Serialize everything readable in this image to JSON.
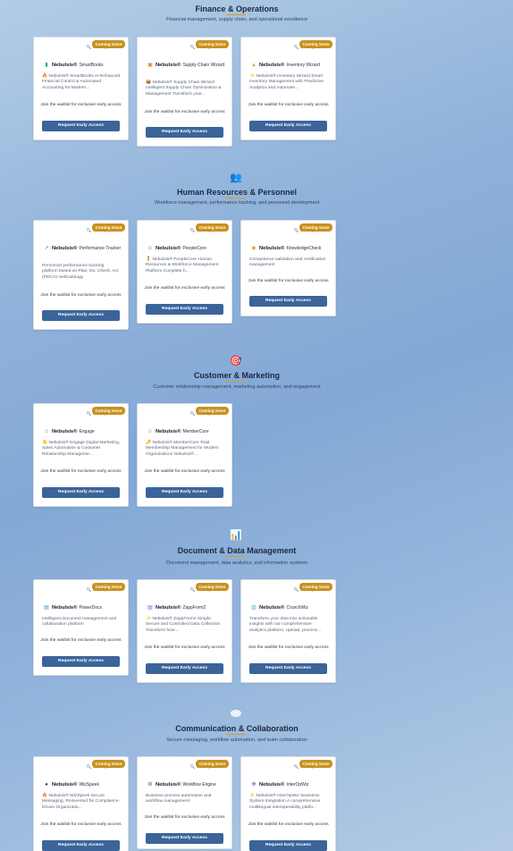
{
  "sections": [
    {
      "icon": "",
      "title_a": "Finance",
      "title_amp": " & ",
      "title_b": "Operations",
      "subtitle": "Financial management, supply chain, and operational excellence",
      "cards": [
        {
          "brand": "Nebulsis®",
          "product": "SmartBooks",
          "icon": "books-icon",
          "desc": "🔥 Nebulsis® SmartBooks AI-Enhanced Financial Control & Automated Accounting for Modern...",
          "waitlist": "Join the waitlist for exclusive early access",
          "button": "Request Early Access",
          "badge": "Coming Soon"
        },
        {
          "brand": "Nebulsis®",
          "product": "Supply Chain Wizard",
          "icon": "truck-icon",
          "desc": "📦 Nebulsis® Supply Chain Wizard Intelligent Supply Chain Optimization & Management Transform your...",
          "waitlist": "Join the waitlist for exclusive early access",
          "button": "Request Early Access",
          "badge": "Coming Soon"
        },
        {
          "brand": "Nebulsis®",
          "product": "Inventory Wizard",
          "icon": "box-icon",
          "desc": "✨ Nebulsis® Inventory Wizard Smart Inventory Management with Predictive Analytics and Automate...",
          "waitlist": "Join the waitlist for exclusive early access",
          "button": "Request Early Access",
          "badge": "Coming Soon"
        }
      ]
    },
    {
      "icon": "👥",
      "title_a": "Human Resources",
      "title_amp": " & ",
      "title_b": "Personnel",
      "subtitle": "Workforce management, performance tracking, and personnel development",
      "cards": [
        {
          "brand": "Nebulsis®",
          "product": "Performance Tracker",
          "icon": "chart-line-icon",
          "desc": "Personnel performance tracking platform based on Plan, Do, Check, Act (PDCA) methodology",
          "waitlist": "Join the waitlist for exclusive early access",
          "button": "Request Early Access",
          "badge": "Coming Soon"
        },
        {
          "brand": "Nebulsis®",
          "product": "PeopleCore",
          "icon": "people-icon",
          "desc": "🧍 Nebulsis® PeopleCore Human Resources & Workforce Management Platform Complete h...",
          "waitlist": "Join the waitlist for exclusive early access",
          "button": "Request Early Access",
          "badge": "Coming Soon"
        },
        {
          "brand": "Nebulsis®",
          "product": "KnowledgeCheck",
          "icon": "lightbulb-icon",
          "desc": "Competence validation and certification management",
          "waitlist": "Join the waitlist for exclusive early access",
          "button": "Request Early Access",
          "badge": "Coming Soon"
        }
      ]
    },
    {
      "icon": "🎯",
      "title_a": "Customer",
      "title_amp": " & ",
      "title_b": "Marketing",
      "subtitle": "Customer relationship management, marketing automation, and engagement",
      "cards": [
        {
          "brand": "Nebulsis®",
          "product": "Engage",
          "icon": "people-icon",
          "desc": "👋 Nebulsis® Engage Digital Marketing, Sales Automation & Customer Relationship Manageme...",
          "waitlist": "Join the waitlist for exclusive early access",
          "button": "Request Early Access",
          "badge": "Coming Soon"
        },
        {
          "brand": "Nebulsis®",
          "product": "MemberCore",
          "icon": "member-icon",
          "desc": "🔑 Nebulsis® MemberCore Total Membership Management for Modern Organizations Nebulsis®...",
          "waitlist": "Join the waitlist for exclusive early access",
          "button": "Request Early Access",
          "badge": "Coming Soon"
        }
      ]
    },
    {
      "icon": "📊",
      "title_a": "Document",
      "title_amp": " & ",
      "title_b": "Data Management",
      "subtitle": "Document management, data analytics, and information systems",
      "cards": [
        {
          "brand": "Nebulsis®",
          "product": "PowerDocs",
          "icon": "document-icon",
          "desc": "Intelligent document management and collaboration platform",
          "waitlist": "Join the waitlist for exclusive early access",
          "button": "Request Early Access",
          "badge": "Coming Soon"
        },
        {
          "brand": "Nebulsis®",
          "product": "ZappForm2",
          "icon": "form-icon",
          "desc": "✨ Nebulsis® ZappForm2 Simple, Secure and Controlled Data Collection Transform how...",
          "waitlist": "Join the waitlist for exclusive early access",
          "button": "Request Early Access",
          "badge": "Coming Soon"
        },
        {
          "brand": "Nebulsis®",
          "product": "CrunchWiz",
          "icon": "analytics-icon",
          "desc": "Transform your data into actionable insights with our comprehensive analytics platform. Upload, process...",
          "waitlist": "Join the waitlist for exclusive early access",
          "button": "Request Early Access",
          "badge": "Coming Soon"
        }
      ]
    },
    {
      "icon": "",
      "title_a": "Communication",
      "title_amp": " & ",
      "title_b": "Collaboration",
      "subtitle": "Secure messaging, workflow automation, and team collaboration",
      "cards": [
        {
          "brand": "Nebulsis®",
          "product": "WizSpeek",
          "icon": "chat-icon",
          "desc": "🔥 Nebulsis® WizSpeek Secure Messaging, Reinvented for Compliance-Driven Organizatio...",
          "waitlist": "Join the waitlist for exclusive early access",
          "button": "Request Early Access",
          "badge": "Coming Soon"
        },
        {
          "brand": "Nebulsis®",
          "product": "Workflow Engine",
          "icon": "gear-icon",
          "desc": "Business process automation and workflow management",
          "waitlist": "Join the waitlist for exclusive early access",
          "button": "Request Early Access",
          "badge": "Coming Soon"
        },
        {
          "brand": "Nebulsis®",
          "product": "InterOpWiz",
          "icon": "puzzle-icon",
          "desc": "⚡ Nebulsis® InterOpWiz Seamless System Integration A comprehensive multilingual interoperability platfo...",
          "waitlist": "Join the waitlist for exclusive early access",
          "button": "Request Early Access",
          "badge": "Coming Soon"
        }
      ]
    }
  ]
}
